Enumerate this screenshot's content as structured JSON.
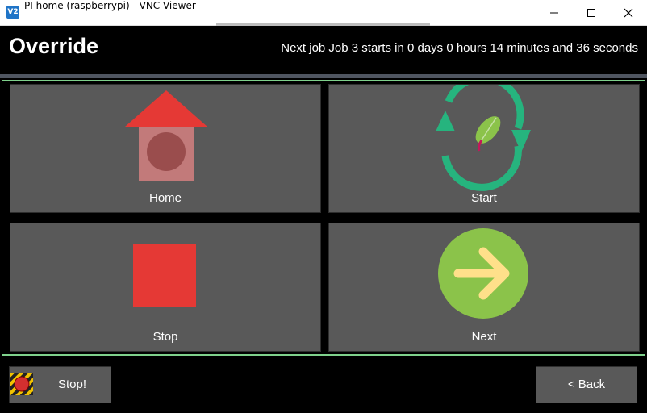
{
  "window": {
    "logo_text": "V2",
    "title": "PI home (raspberrypi) - VNC Viewer"
  },
  "header": {
    "title": "Override",
    "next_job_text": "Next job Job 3 starts in 0 days 0 hours 14 minutes and 36 seconds"
  },
  "tiles": [
    {
      "label": "Home",
      "icon": "home-icon"
    },
    {
      "label": "Start",
      "icon": "recycle-leaf-icon"
    },
    {
      "label": "Stop",
      "icon": "stop-square-icon"
    },
    {
      "label": "Next",
      "icon": "arrow-right-circle-icon"
    }
  ],
  "footer": {
    "emergency_stop_label": "Stop!",
    "back_label": "< Back"
  },
  "colors": {
    "accent_green": "#7fd18c",
    "tile_bg": "#595959",
    "stop_red": "#e53935",
    "next_green": "#8bc34a",
    "start_teal": "#26b47e"
  }
}
